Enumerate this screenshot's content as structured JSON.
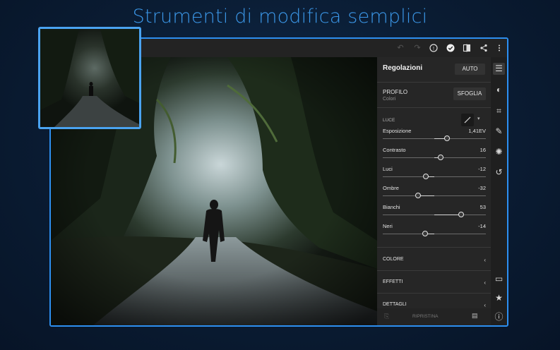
{
  "headline": "Strumenti di modifica semplici",
  "topbar": {
    "icons": [
      "undo-icon",
      "redo-icon",
      "help-icon",
      "check-circle-icon",
      "compare-icon",
      "share-icon",
      "more-icon"
    ]
  },
  "panel": {
    "title": "Regolazioni",
    "auto_label": "AUTO",
    "profile_label": "PROFILO",
    "profile_value": "Colori",
    "browse_label": "SFOGLIA",
    "light_label": "LUCE",
    "sliders": [
      {
        "name": "Esposizione",
        "value": "1,41EV",
        "level": 0.62
      },
      {
        "name": "Contrasto",
        "value": "16",
        "level": 0.56
      },
      {
        "name": "Luci",
        "value": "-12",
        "level": 0.42
      },
      {
        "name": "Ombre",
        "value": "-32",
        "level": 0.34
      },
      {
        "name": "Bianchi",
        "value": "53",
        "level": 0.76
      },
      {
        "name": "Neri",
        "value": "-14",
        "level": 0.41
      }
    ],
    "sections": [
      "COLORE",
      "EFFETTI",
      "DETTAGLI"
    ],
    "reset_label": "RIPRISTINA"
  },
  "rail": {
    "icons": [
      "sliders-icon",
      "color-mix-icon",
      "crop-icon",
      "healing-brush-icon",
      "filter-icon",
      "history-icon",
      "comment-icon",
      "star-icon",
      "info-icon"
    ]
  },
  "colors": {
    "accent": "#2d8ff0",
    "headline": "#3b97e8",
    "panel": "#262626"
  }
}
